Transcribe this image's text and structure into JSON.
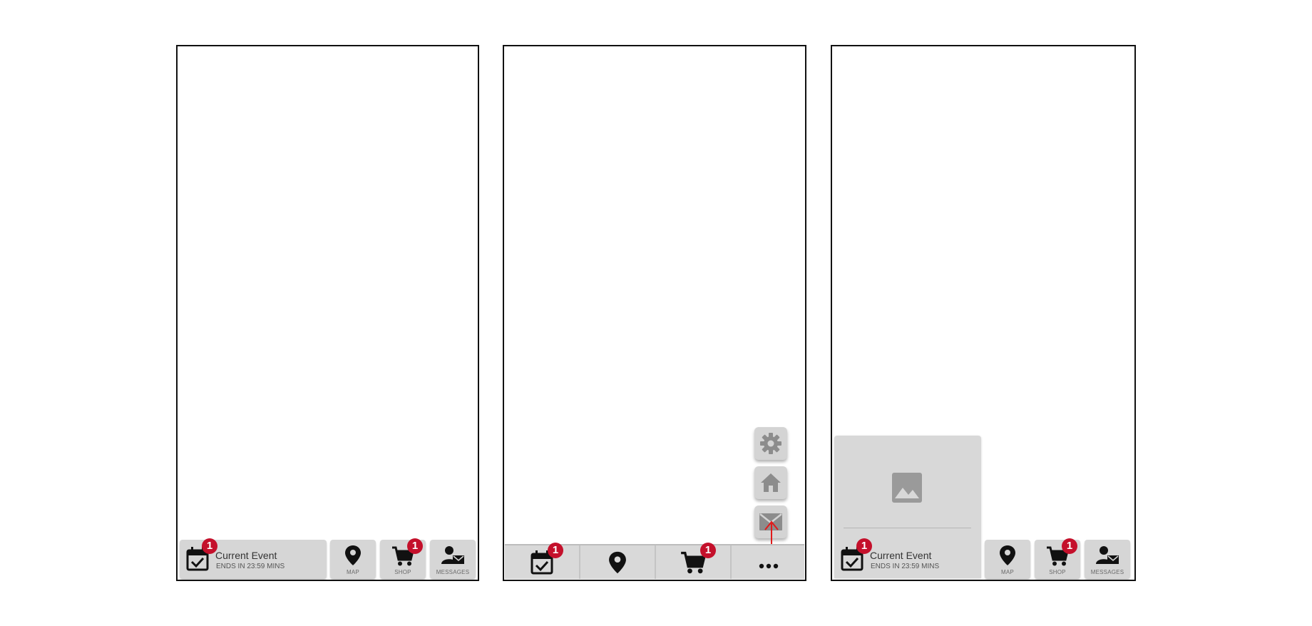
{
  "event": {
    "title": "Current Event",
    "subtitle": "ENDS IN 23:59 MINS",
    "badge": "1"
  },
  "tabs": {
    "map": "MAP",
    "shop": "SHOP",
    "messages": "MESSAGES",
    "shop_badge": "1"
  },
  "colors": {
    "badge": "#c4102b",
    "bar": "#d6d6d6",
    "arrow": "#e01b1b"
  },
  "mockups": [
    {
      "id": "bottom-bar-labeled"
    },
    {
      "id": "bottom-bar-icons-with-speed-dial",
      "speed_dial_icons": [
        "gear-icon",
        "home-icon",
        "mail-icon"
      ]
    },
    {
      "id": "bottom-bar-with-expanded-event-panel",
      "panel_icon": "image-icon"
    }
  ]
}
